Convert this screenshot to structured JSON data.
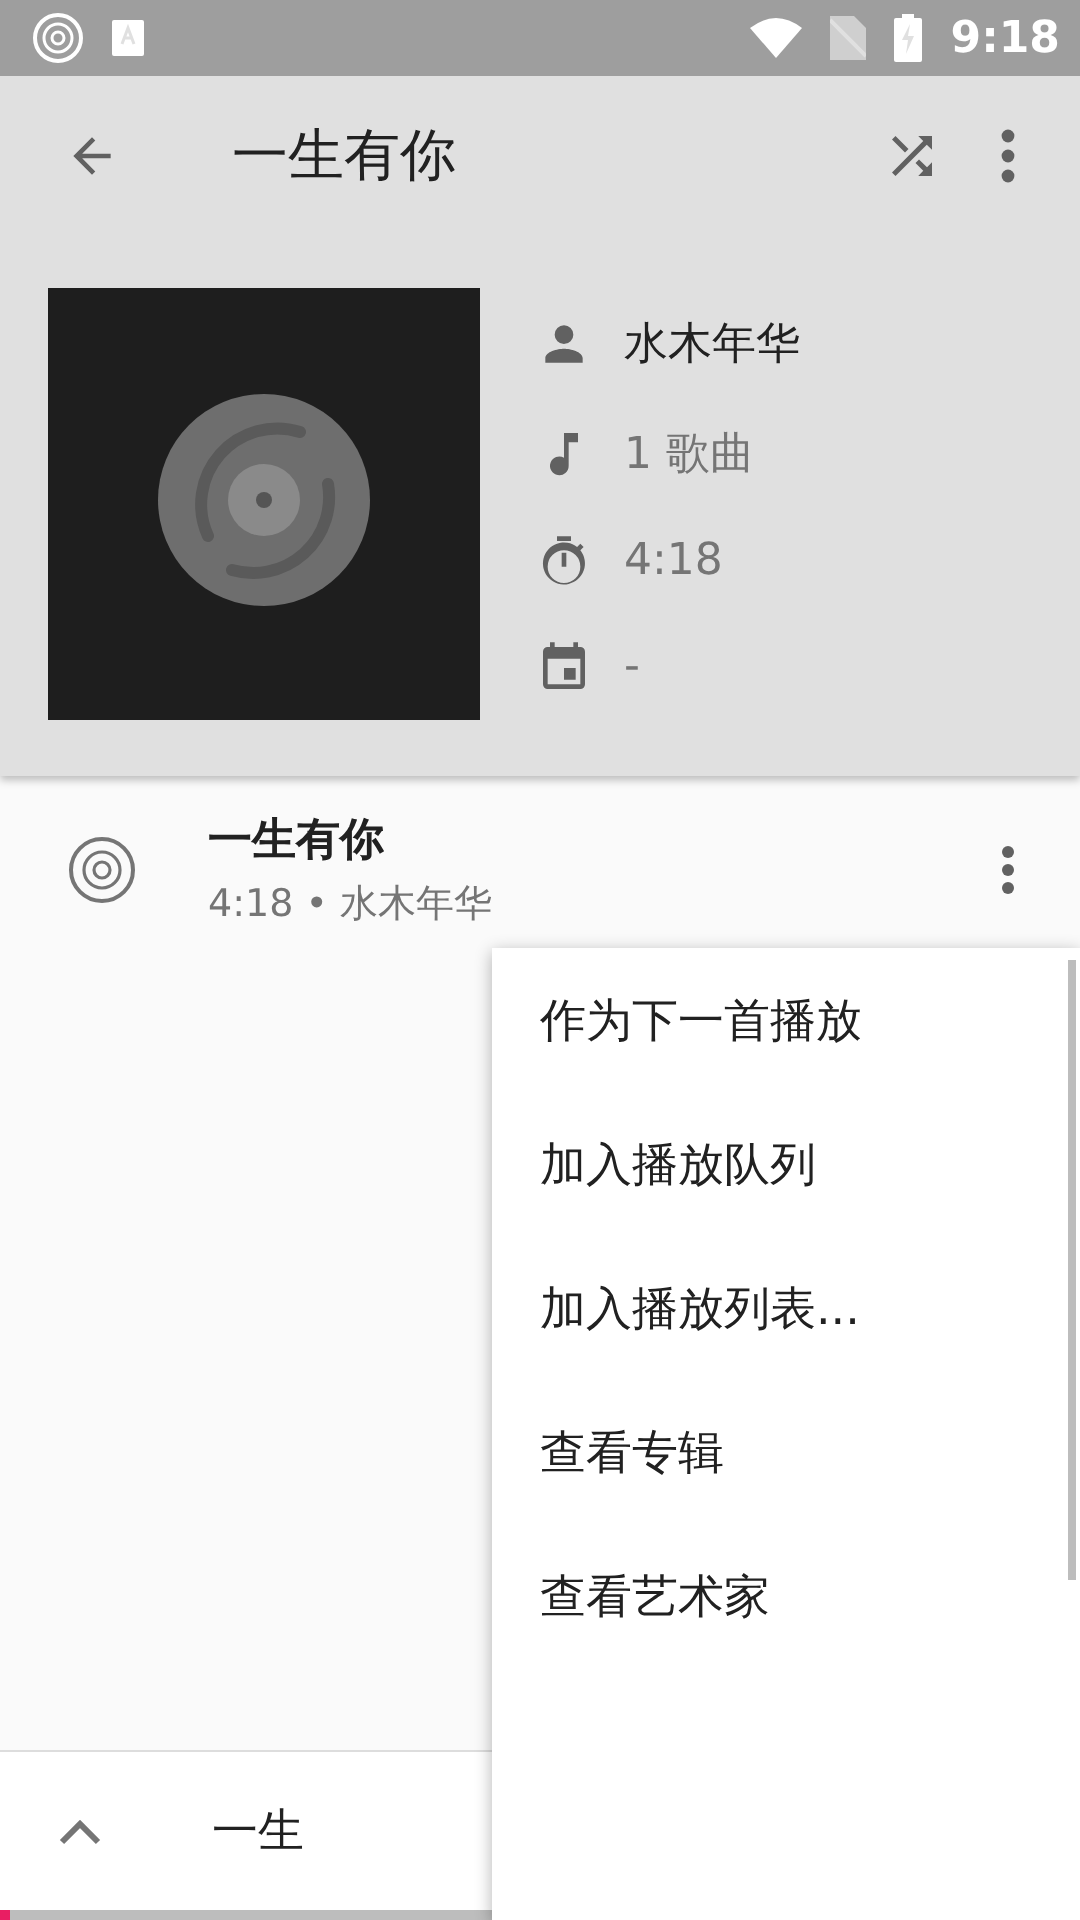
{
  "status_bar": {
    "time": "9:18"
  },
  "toolbar": {
    "title": "一生有你"
  },
  "album": {
    "artist": "水木年华",
    "songs": "1 歌曲",
    "duration": "4:18",
    "year": "-"
  },
  "songs": [
    {
      "title": "一生有你",
      "subtitle": "4:18 • 水木年华"
    }
  ],
  "menu": {
    "items": [
      "作为下一首播放",
      "加入播放队列",
      "加入播放列表...",
      "查看专辑",
      "查看艺术家"
    ]
  },
  "mini_player": {
    "title": "一生",
    "level": 0.01
  }
}
